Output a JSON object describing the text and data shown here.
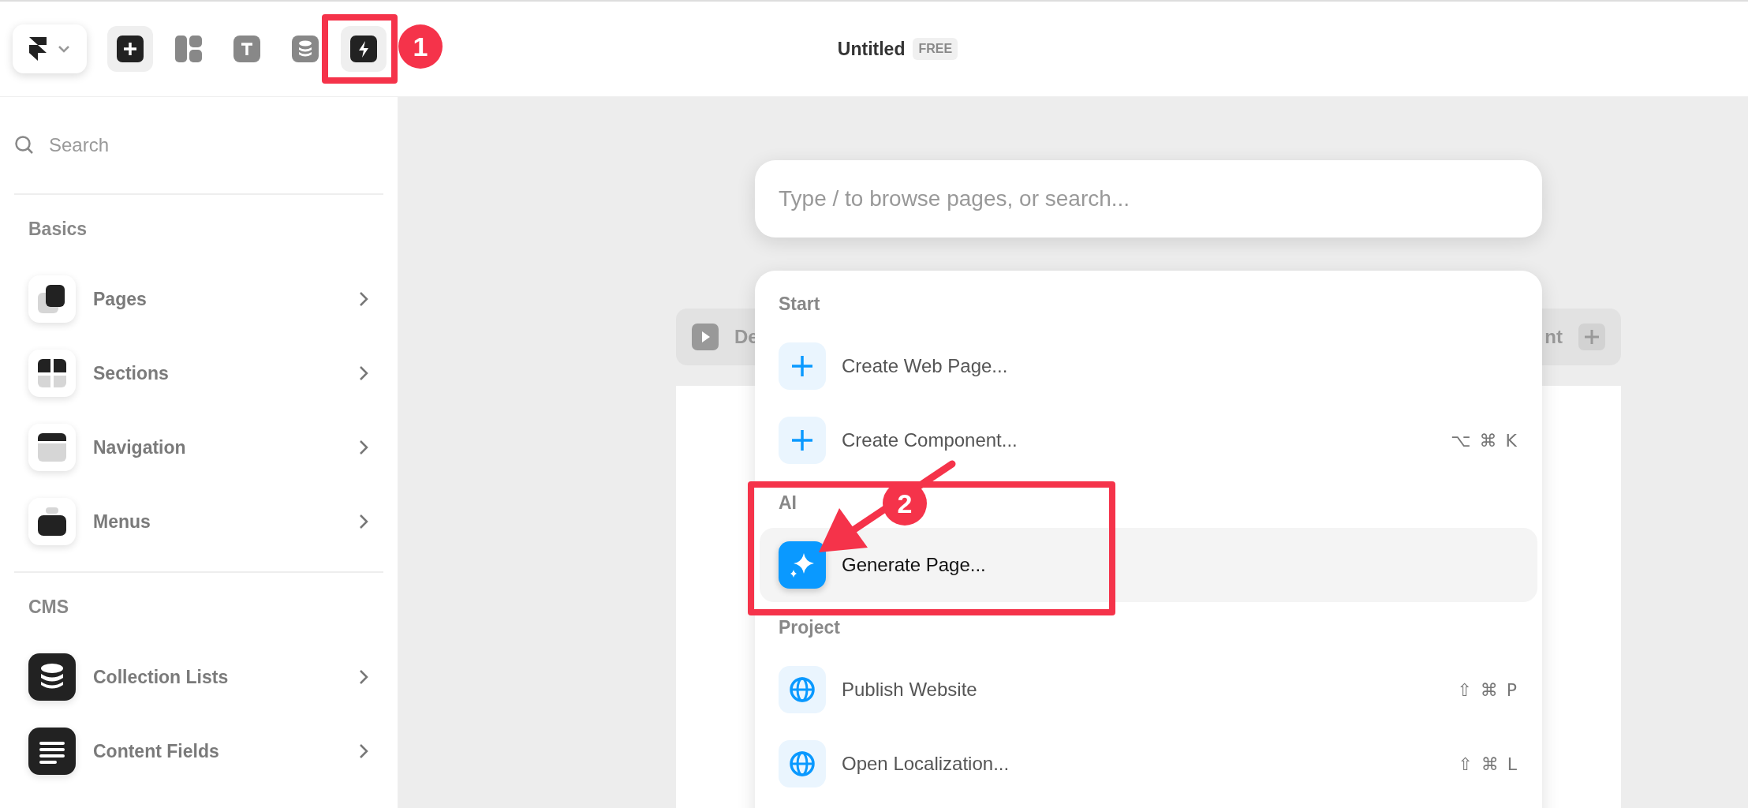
{
  "toolbar": {
    "tools": [
      {
        "kind": "plus",
        "selected": true
      },
      {
        "kind": "layout",
        "selected": false
      },
      {
        "kind": "text",
        "selected": false
      },
      {
        "kind": "database",
        "selected": false
      },
      {
        "kind": "bolt",
        "selected": true
      }
    ]
  },
  "document": {
    "title": "Untitled",
    "plan_badge": "FREE"
  },
  "sidebar": {
    "search": {
      "placeholder": "Search"
    },
    "sections": [
      {
        "title": "Basics",
        "items": [
          {
            "label": "Pages",
            "kind": "pages"
          },
          {
            "label": "Sections",
            "kind": "sections"
          },
          {
            "label": "Navigation",
            "kind": "navigation"
          },
          {
            "label": "Menus",
            "kind": "menus"
          }
        ]
      },
      {
        "title": "CMS",
        "items": [
          {
            "label": "Collection Lists",
            "kind": "collection"
          },
          {
            "label": "Content Fields",
            "kind": "fields"
          }
        ]
      }
    ]
  },
  "canvas": {
    "breakpoint_bar": {
      "left_label": "De",
      "right_label": "nt"
    }
  },
  "command_palette": {
    "search": {
      "placeholder": "Type / to browse pages, or search..."
    },
    "groups": [
      {
        "title": "Start",
        "items": [
          {
            "label": "Create Web Page...",
            "kind": "plus",
            "selected": false
          },
          {
            "label": "Create Component...",
            "kind": "plus",
            "shortcut": "⌥ ⌘ K",
            "selected": false
          }
        ]
      },
      {
        "title": "AI",
        "items": [
          {
            "label": "Generate Page...",
            "kind": "sparkle",
            "selected": true
          }
        ]
      },
      {
        "title": "Project",
        "items": [
          {
            "label": "Publish Website",
            "kind": "globe",
            "shortcut": "⇧ ⌘ P",
            "selected": false
          },
          {
            "label": "Open Localization...",
            "kind": "globe",
            "shortcut": "⇧ ⌘ L",
            "selected": false
          }
        ]
      }
    ]
  },
  "annotations": [
    {
      "number": "1"
    },
    {
      "number": "2"
    }
  ]
}
